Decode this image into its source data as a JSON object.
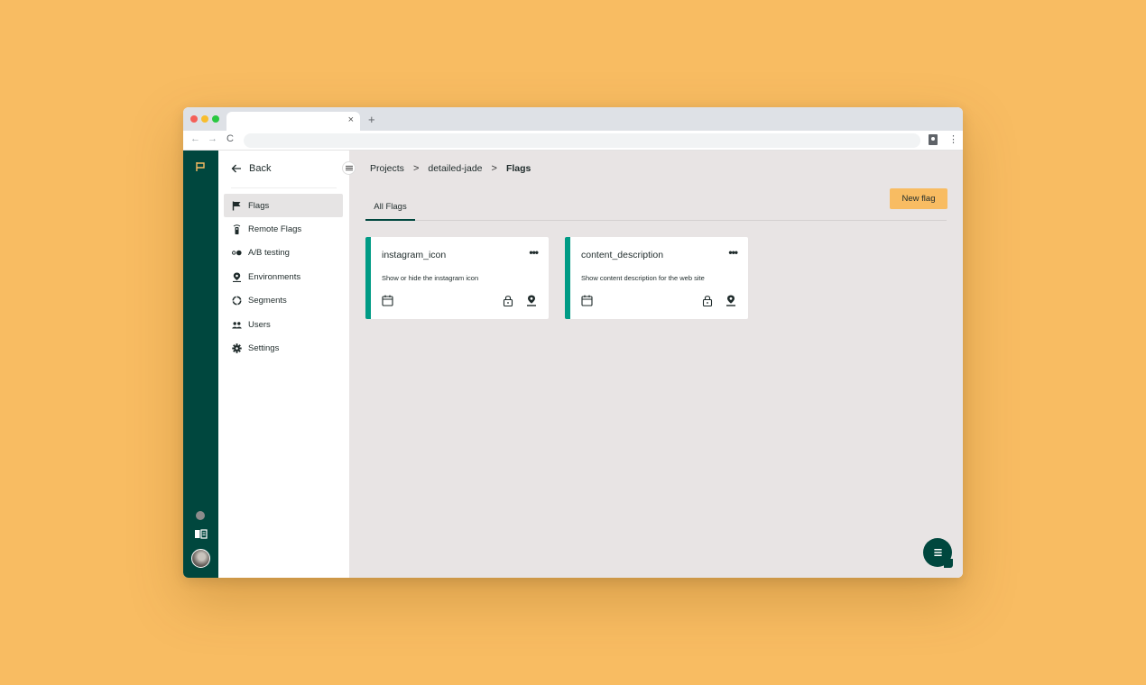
{
  "browser": {
    "tab_close": "×",
    "new_tab": "+",
    "nav": {
      "back": "←",
      "forward": "→",
      "reload": "C"
    },
    "kebab": "⋮",
    "lights": [
      "#f45f58",
      "#f8bd2e",
      "#29c840"
    ]
  },
  "sidebar": {
    "back_label": "Back",
    "items": [
      {
        "label": "Flags",
        "icon": "flag-icon",
        "active": true
      },
      {
        "label": "Remote Flags",
        "icon": "remote-icon",
        "active": false
      },
      {
        "label": "A/B testing",
        "icon": "ab-icon",
        "active": false
      },
      {
        "label": "Environments",
        "icon": "environment-icon",
        "active": false
      },
      {
        "label": "Segments",
        "icon": "segment-icon",
        "active": false
      },
      {
        "label": "Users",
        "icon": "users-icon",
        "active": false
      },
      {
        "label": "Settings",
        "icon": "gear-icon",
        "active": false
      }
    ]
  },
  "breadcrumb": {
    "items": [
      "Projects",
      "detailed-jade",
      "Flags"
    ],
    "separator": ">"
  },
  "tabs": {
    "all_flags": "All Flags"
  },
  "new_flag_label": "New flag",
  "cards": [
    {
      "title": "instagram_icon",
      "description": "Show or hide the instagram icon",
      "more": "•••"
    },
    {
      "title": "content_description",
      "description": "Show content description for the web site",
      "more": "•••"
    }
  ],
  "colors": {
    "background": "#f8bc62",
    "rail": "#00473e",
    "accent": "#009b85",
    "button": "#f8bc62"
  }
}
